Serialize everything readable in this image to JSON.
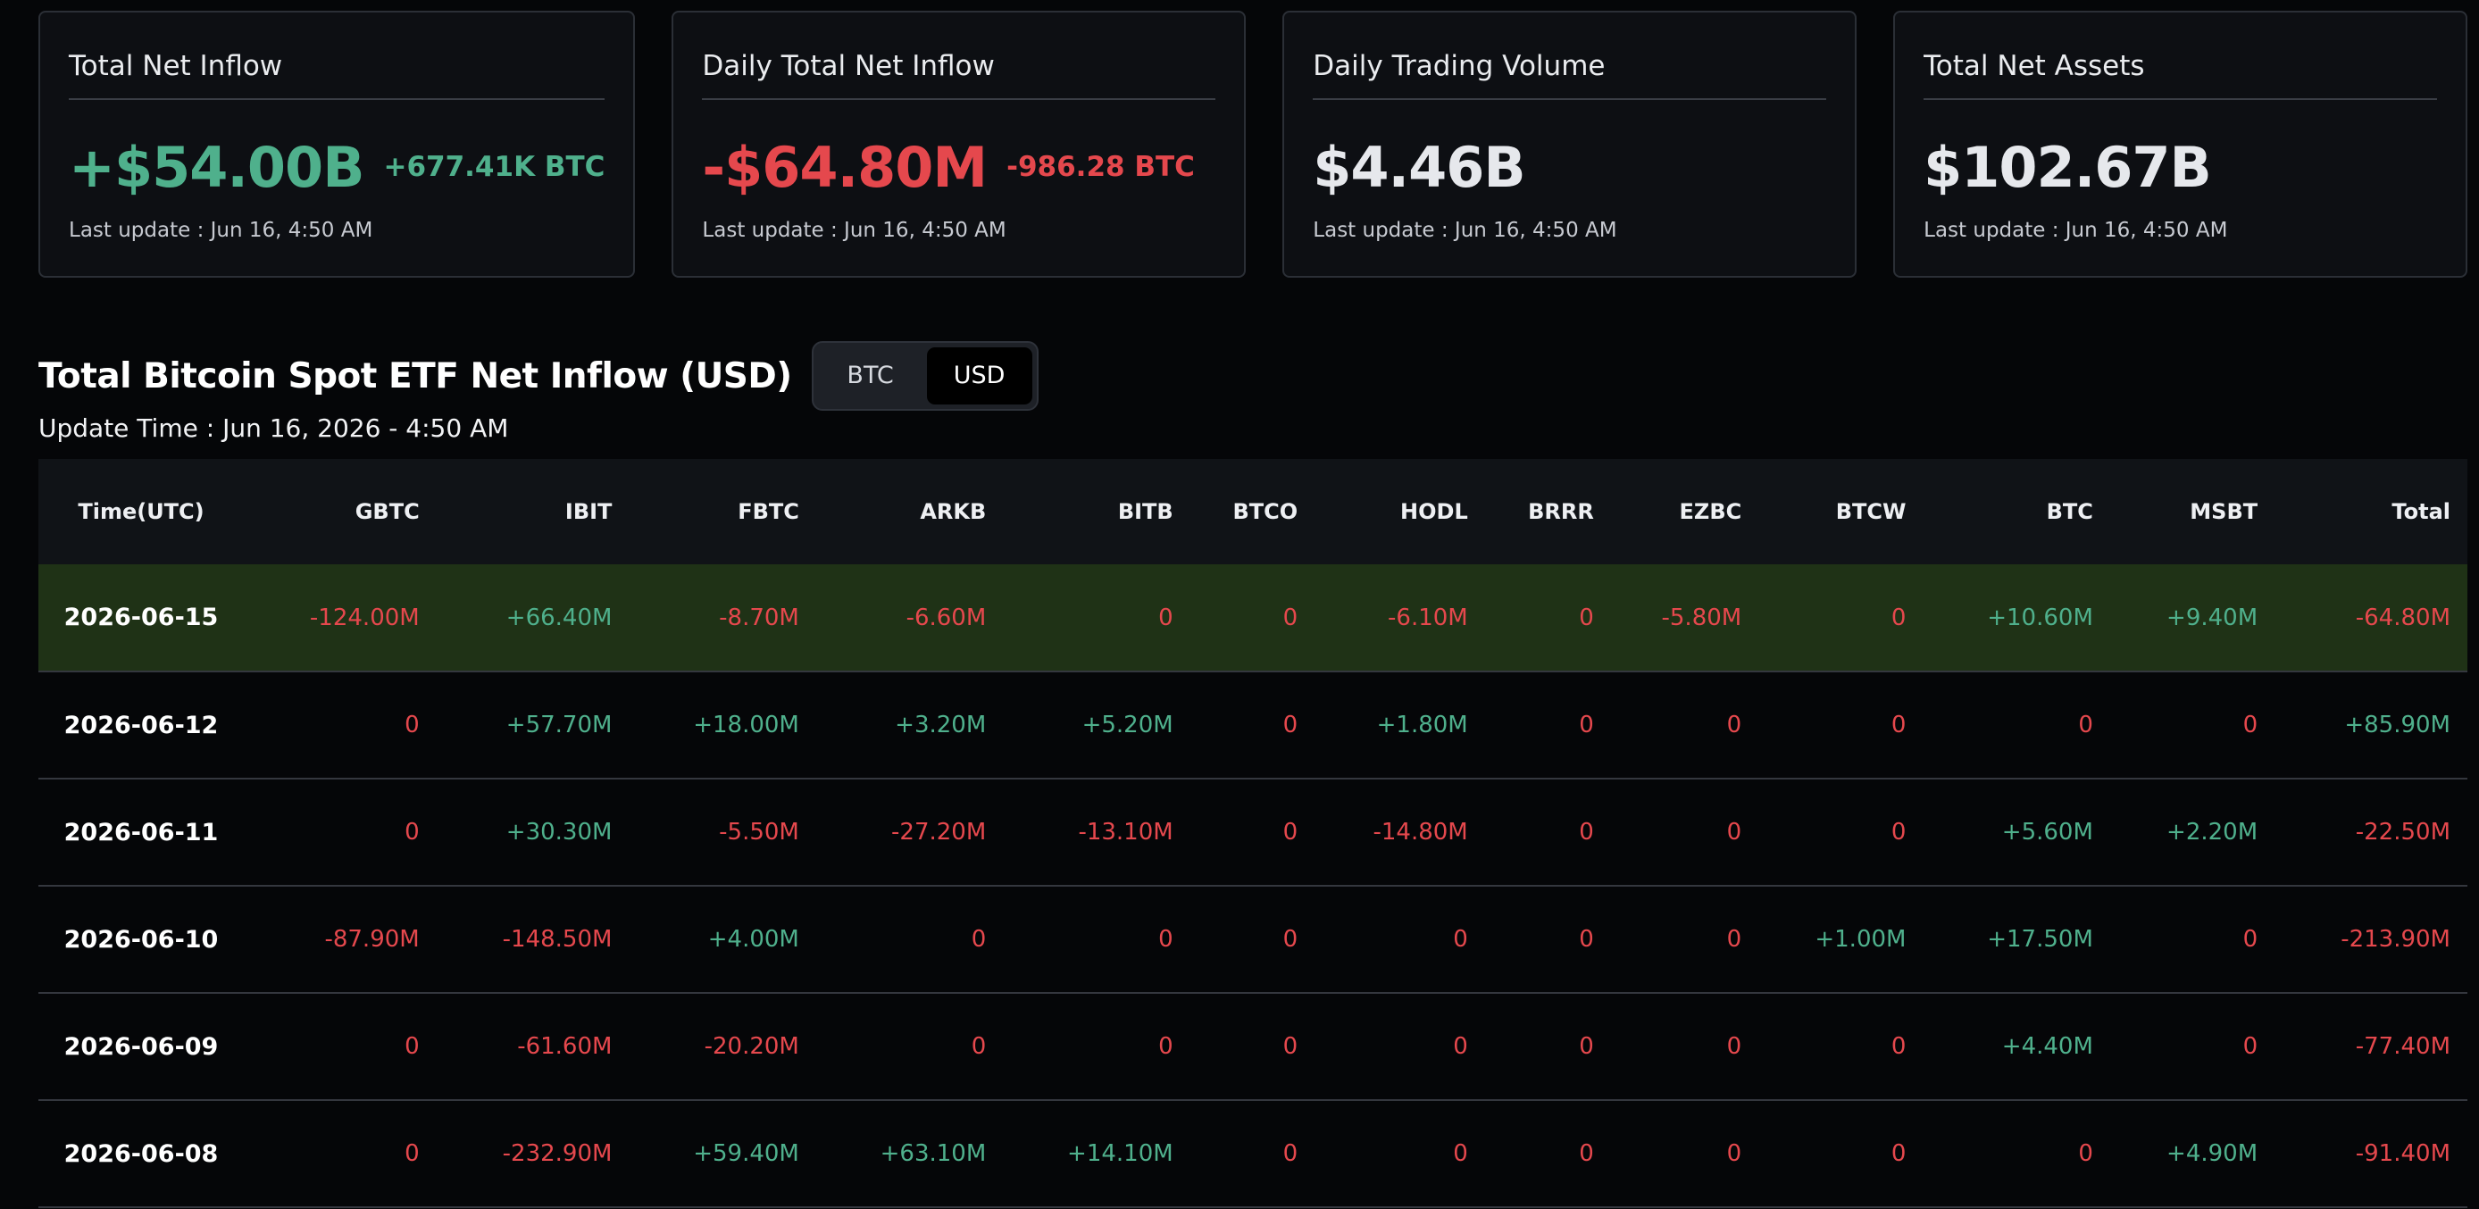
{
  "cards": [
    {
      "title": "Total Net Inflow",
      "value": "+$54.00B",
      "value_tone": "pos",
      "sub": "+677.41K BTC",
      "sub_tone": "pos",
      "update": "Last update : Jun 16, 4:50 AM"
    },
    {
      "title": "Daily Total Net Inflow",
      "value": "-$64.80M",
      "value_tone": "neg",
      "sub": "-986.28 BTC",
      "sub_tone": "neg",
      "update": "Last update : Jun 16, 4:50 AM"
    },
    {
      "title": "Daily Trading Volume",
      "value": "$4.46B",
      "value_tone": "neutral",
      "sub": "",
      "sub_tone": "neutral",
      "update": "Last update : Jun 16, 4:50 AM"
    },
    {
      "title": "Total Net Assets",
      "value": "$102.67B",
      "value_tone": "neutral",
      "sub": "",
      "sub_tone": "neutral",
      "update": "Last update : Jun 16, 4:50 AM"
    }
  ],
  "section": {
    "title": "Total Bitcoin Spot ETF Net Inflow (USD)",
    "toggle": {
      "options": [
        "BTC",
        "USD"
      ],
      "selected": "USD"
    },
    "update_time": "Update Time : Jun 16, 2026 - 4:50 AM"
  },
  "table": {
    "columns": [
      "Time(UTC)",
      "GBTC",
      "IBIT",
      "FBTC",
      "ARKB",
      "BITB",
      "BTCO",
      "HODL",
      "BRRR",
      "EZBC",
      "BTCW",
      "BTC",
      "MSBT",
      "Total"
    ],
    "rows": [
      {
        "highlight": true,
        "cells": [
          "2026-06-15",
          "-124.00M",
          "+66.40M",
          "-8.70M",
          "-6.60M",
          "0",
          "0",
          "-6.10M",
          "0",
          "-5.80M",
          "0",
          "+10.60M",
          "+9.40M",
          "-64.80M"
        ]
      },
      {
        "highlight": false,
        "cells": [
          "2026-06-12",
          "0",
          "+57.70M",
          "+18.00M",
          "+3.20M",
          "+5.20M",
          "0",
          "+1.80M",
          "0",
          "0",
          "0",
          "0",
          "0",
          "+85.90M"
        ]
      },
      {
        "highlight": false,
        "cells": [
          "2026-06-11",
          "0",
          "+30.30M",
          "-5.50M",
          "-27.20M",
          "-13.10M",
          "0",
          "-14.80M",
          "0",
          "0",
          "0",
          "+5.60M",
          "+2.20M",
          "-22.50M"
        ]
      },
      {
        "highlight": false,
        "cells": [
          "2026-06-10",
          "-87.90M",
          "-148.50M",
          "+4.00M",
          "0",
          "0",
          "0",
          "0",
          "0",
          "0",
          "+1.00M",
          "+17.50M",
          "0",
          "-213.90M"
        ]
      },
      {
        "highlight": false,
        "cells": [
          "2026-06-09",
          "0",
          "-61.60M",
          "-20.20M",
          "0",
          "0",
          "0",
          "0",
          "0",
          "0",
          "0",
          "+4.40M",
          "0",
          "-77.40M"
        ]
      },
      {
        "highlight": false,
        "cells": [
          "2026-06-08",
          "0",
          "-232.90M",
          "+59.40M",
          "+63.10M",
          "+14.10M",
          "0",
          "0",
          "0",
          "0",
          "0",
          "0",
          "+4.90M",
          "-91.40M"
        ]
      }
    ]
  },
  "colors": {
    "positive": "#4fb08c",
    "negative": "#e5484d",
    "highlight_row": "#1f3216"
  }
}
